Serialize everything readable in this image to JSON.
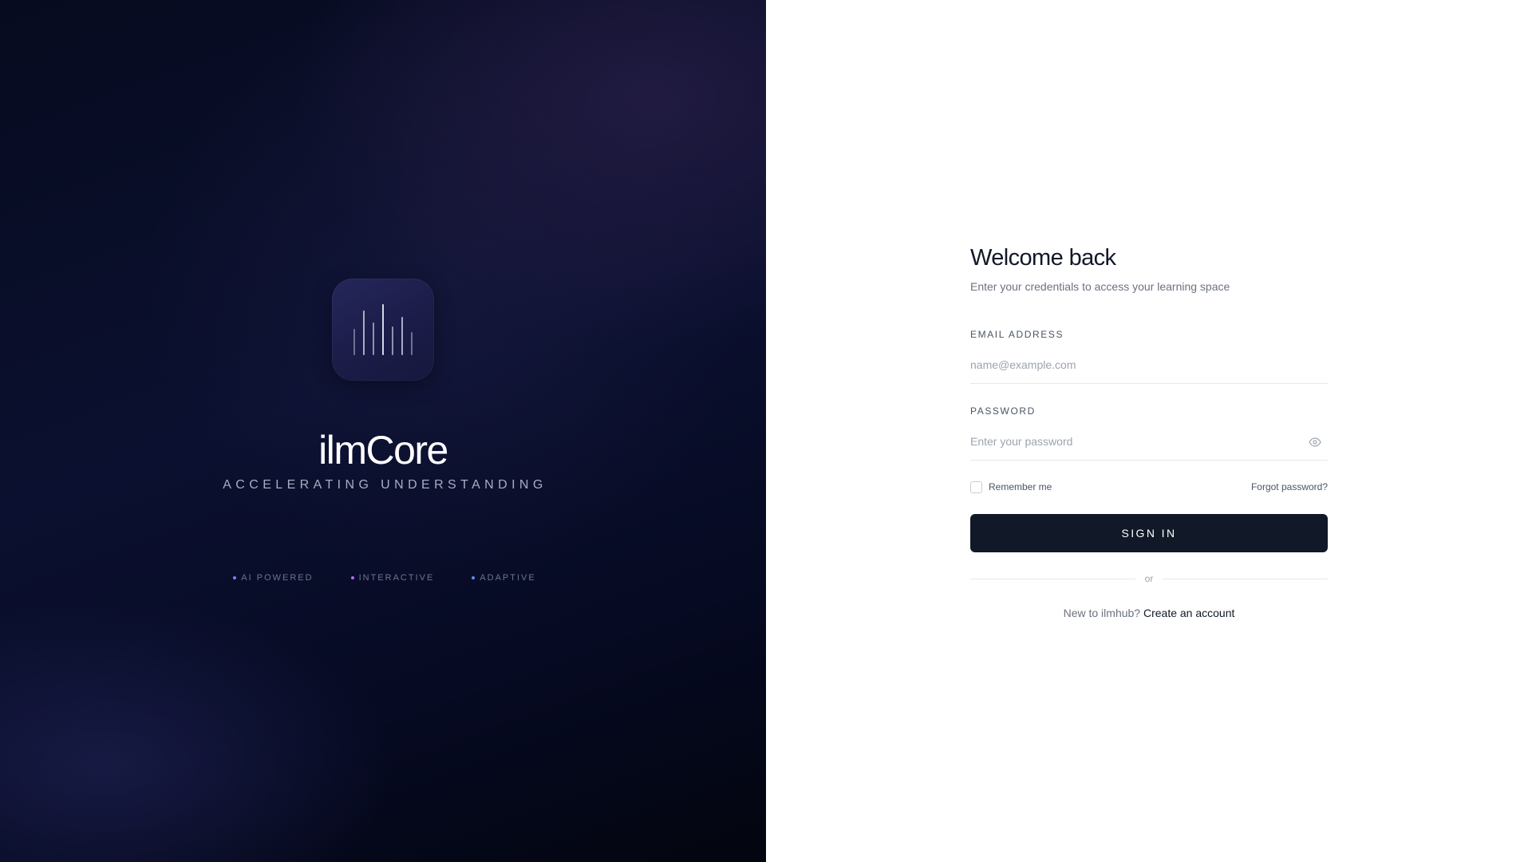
{
  "brand": {
    "name": "ilmCore",
    "tagline": "ACCELERATING UNDERSTANDING",
    "logo_icon": "audio-bars-icon",
    "features": [
      {
        "label": "AI POWERED",
        "color": "#7c83f0"
      },
      {
        "label": "INTERACTIVE",
        "color": "#b06cf0"
      },
      {
        "label": "ADAPTIVE",
        "color": "#5b8cf0"
      }
    ]
  },
  "form": {
    "title": "Welcome back",
    "subtitle": "Enter your credentials to access your learning space",
    "email": {
      "label": "EMAIL ADDRESS",
      "placeholder": "name@example.com",
      "value": ""
    },
    "password": {
      "label": "PASSWORD",
      "placeholder": "Enter your password",
      "value": "",
      "toggle_icon": "eye-icon"
    },
    "remember_label": "Remember me",
    "remember_checked": false,
    "forgot_label": "Forgot password?",
    "submit_label": "SIGN IN",
    "divider_label": "or",
    "signup_prompt": "New to ilmhub?",
    "signup_link": "Create an account"
  },
  "colors": {
    "primary_button": "#111827",
    "panel_dark": "#0b1030"
  }
}
